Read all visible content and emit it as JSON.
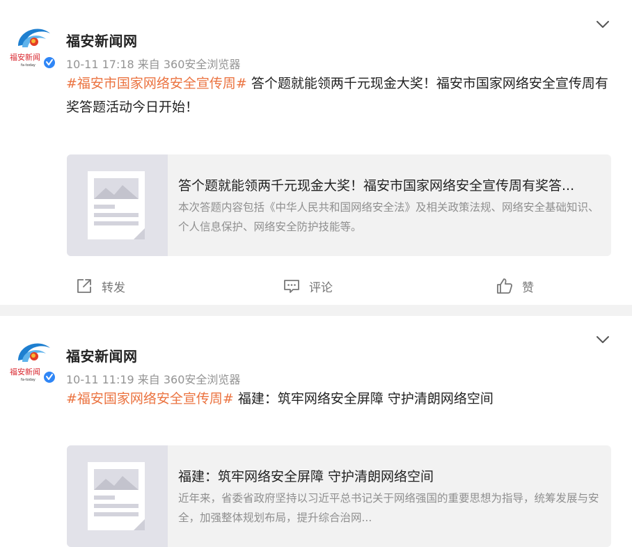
{
  "colors": {
    "hashtag": "#eb7340",
    "separator": "#f2f2f2",
    "card_bg": "#f2f2f2",
    "verified": "#2f86f6"
  },
  "posts": [
    {
      "author": "福安新闻网",
      "meta": "10-11 17:18  来自 360安全浏览器",
      "avatar": {
        "logo_text": "福安新闻",
        "logo_sub": "fa-today",
        "badge": "V"
      },
      "hashtag": "#福安市国家网络安全宣传周#",
      "text": " 答个题就能领两千元现金大奖！福安市国家网络安全宣传周有奖答题活动今日开始！",
      "card": {
        "title": "答个题就能领两千元现金大奖！福安市国家网络安全宣传周有奖答...",
        "desc": "本次答题内容包括《中华人民共和国网络安全法》及相关政策法规、网络安全基础知识、个人信息保护、网络安全防护技能等。"
      },
      "actions": {
        "repost": "转发",
        "comment": "评论",
        "like": "赞"
      },
      "icons": [
        "chevron-down-icon",
        "repost-icon",
        "comment-icon",
        "like-icon",
        "article-icon"
      ]
    },
    {
      "author": "福安新闻网",
      "meta": "10-11 11:19  来自 360安全浏览器",
      "avatar": {
        "logo_text": "福安新闻",
        "logo_sub": "fa-today",
        "badge": "V"
      },
      "hashtag": "#福安国家网络安全宣传周#",
      "text": " 福建：筑牢网络安全屏障 守护清朗网络空间",
      "card": {
        "title": "福建：筑牢网络安全屏障 守护清朗网络空间",
        "desc": "近年来，省委省政府坚持以习近平总书记关于网络强国的重要思想为指导，统筹发展与安全，加强整体规划布局，提升综合治网..."
      }
    }
  ]
}
